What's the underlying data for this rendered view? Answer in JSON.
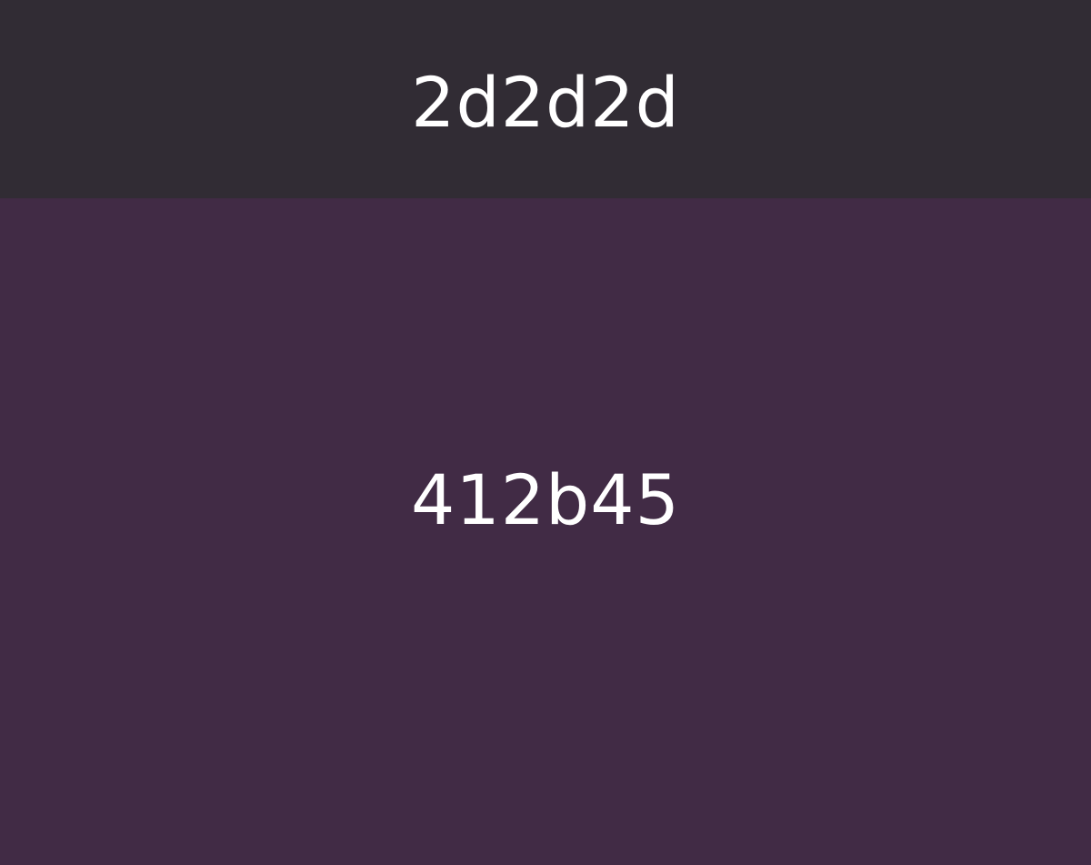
{
  "swatches": [
    {
      "label": "2d2d2d",
      "color": "#312c34"
    },
    {
      "label": "412b45",
      "color": "#412b45"
    }
  ],
  "text_color": "#ffffff"
}
